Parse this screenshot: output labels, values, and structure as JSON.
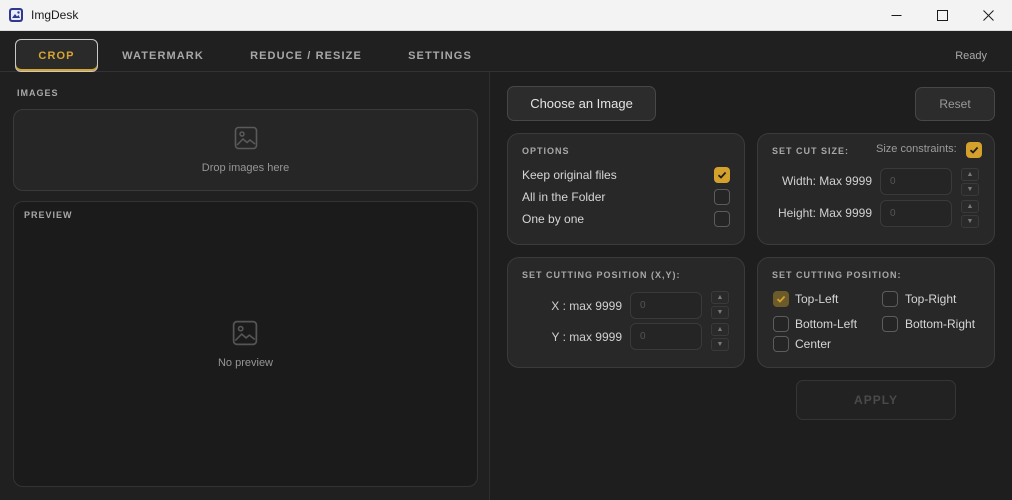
{
  "window": {
    "title": "ImgDesk"
  },
  "tabs": [
    {
      "label": "CROP",
      "active": true
    },
    {
      "label": "WATERMARK",
      "active": false
    },
    {
      "label": "REDUCE / RESIZE",
      "active": false
    },
    {
      "label": "SETTINGS",
      "active": false
    }
  ],
  "status": "Ready",
  "left": {
    "images_label": "IMAGES",
    "drop_text": "Drop images here",
    "preview_label": "PREVIEW",
    "no_preview_text": "No preview"
  },
  "right": {
    "choose_button": "Choose an Image",
    "reset_button": "Reset",
    "options": {
      "title": "OPTIONS",
      "items": [
        {
          "label": "Keep original files",
          "checked": true
        },
        {
          "label": "All in the Folder",
          "checked": false
        },
        {
          "label": "One by one",
          "checked": false
        }
      ]
    },
    "cut_size": {
      "title": "SET CUT SIZE:",
      "constraints_label": "Size constraints:",
      "constraints_checked": true,
      "width_label": "Width: Max 9999",
      "width_placeholder": "0",
      "height_label": "Height: Max 9999",
      "height_placeholder": "0"
    },
    "cut_xy": {
      "title": "SET CUTTING POSITION (X,Y):",
      "x_label": "X : max 9999",
      "x_placeholder": "0",
      "y_label": "Y : max 9999",
      "y_placeholder": "0"
    },
    "cut_position": {
      "title": "SET CUTTING POSITION:",
      "options": [
        {
          "label": "Top-Left",
          "checked": true
        },
        {
          "label": "Top-Right",
          "checked": false
        },
        {
          "label": "Bottom-Left",
          "checked": false
        },
        {
          "label": "Bottom-Right",
          "checked": false
        },
        {
          "label": "Center",
          "checked": false
        }
      ]
    },
    "apply_button": "APPLY"
  },
  "colors": {
    "accent": "#d4a12d",
    "background": "#1e1e1e"
  },
  "icons": {
    "app": "app-logo-icon",
    "placeholder": "image-icon",
    "spin_up": "▲",
    "spin_down": "▼"
  }
}
